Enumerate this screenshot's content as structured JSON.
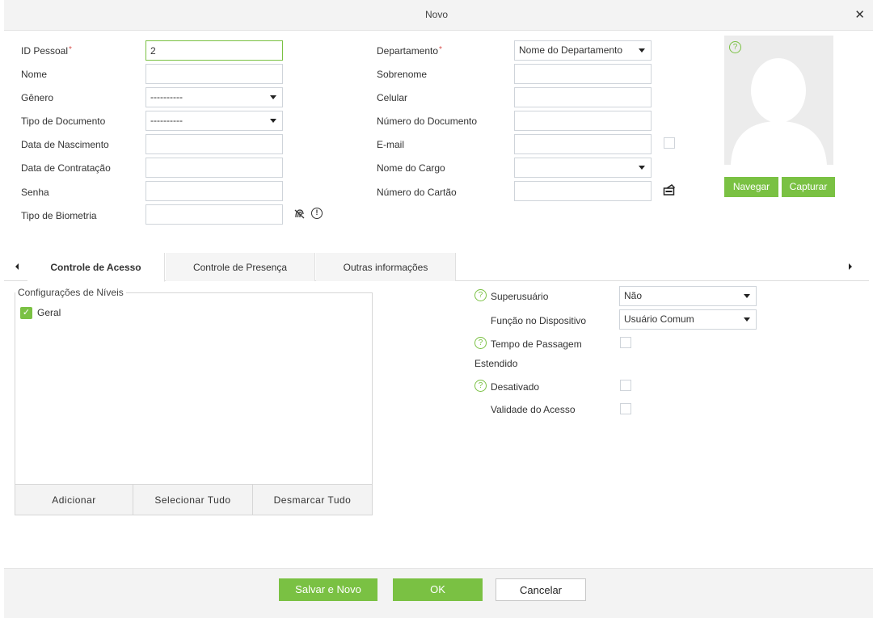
{
  "dialog": {
    "title": "Novo",
    "close_glyph": "✕"
  },
  "left_form": {
    "personal_id": {
      "label": "ID Pessoal",
      "required": "*",
      "value": "2"
    },
    "first_name": {
      "label": "Nome",
      "value": ""
    },
    "gender": {
      "label": "Gênero",
      "value": "----------"
    },
    "document_type": {
      "label": "Tipo de Documento",
      "value": "----------"
    },
    "birth_date": {
      "label": "Data de Nascimento",
      "value": ""
    },
    "hire_date": {
      "label": "Data de Contratação",
      "value": ""
    },
    "password": {
      "label": "Senha",
      "value": ""
    },
    "biometric_type": {
      "label": "Tipo de Biometria",
      "value": ""
    }
  },
  "right_form": {
    "department": {
      "label": "Departamento",
      "required": "*",
      "value": "Nome do Departamento"
    },
    "last_name": {
      "label": "Sobrenome",
      "value": ""
    },
    "mobile": {
      "label": "Celular",
      "value": ""
    },
    "document_number": {
      "label": "Número do Documento",
      "value": ""
    },
    "email": {
      "label": "E-mail",
      "value": ""
    },
    "job_title": {
      "label": "Nome do Cargo",
      "value": ""
    },
    "card_number": {
      "label": "Número do Cartão",
      "value": ""
    }
  },
  "photo": {
    "browse_label": "Navegar",
    "capture_label": "Capturar"
  },
  "tabs": [
    {
      "label": "Controle de Acesso",
      "active": true
    },
    {
      "label": "Controle de Presença",
      "active": false
    },
    {
      "label": "Outras informações",
      "active": false
    }
  ],
  "levels": {
    "legend": "Configurações de Níveis",
    "items": [
      {
        "label": "Geral",
        "checked": true
      }
    ],
    "add_label": "Adicionar",
    "select_all_label": "Selecionar Tudo",
    "deselect_all_label": "Desmarcar Tudo"
  },
  "access": {
    "superuser": {
      "label": "Superusuário",
      "value": "Não"
    },
    "device_role": {
      "label": "Função no Dispositivo",
      "value": "Usuário Comum"
    },
    "extended_passage": {
      "label": "Tempo de Passagem",
      "label2": "Estendido",
      "checked": false
    },
    "disabled": {
      "label": "Desativado",
      "checked": false
    },
    "access_validity": {
      "label": "Validade do Acesso",
      "checked": false
    }
  },
  "footer": {
    "save_new_label": "Salvar e Novo",
    "ok_label": "OK",
    "cancel_label": "Cancelar"
  },
  "colors": {
    "accent": "#7ac143",
    "required": "#d9534f",
    "photo_bg": "#ececec"
  },
  "icons": {
    "biometric": "fingerprint-icon",
    "info": "info-icon",
    "card_reader": "card-reader-icon",
    "help": "help-circle-icon",
    "check": "checkmark-icon"
  }
}
